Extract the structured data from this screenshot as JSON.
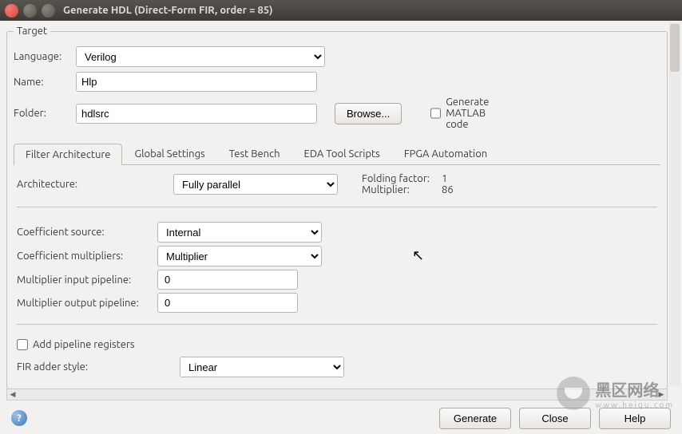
{
  "window": {
    "title": "Generate HDL (Direct-Form FIR, order = 85)"
  },
  "target": {
    "legend": "Target",
    "language_label": "Language:",
    "language_value": "Verilog",
    "name_label": "Name:",
    "name_value": "Hlp",
    "folder_label": "Folder:",
    "folder_value": "hdlsrc",
    "browse_label": "Browse...",
    "gen_matlab_label": "Generate MATLAB code"
  },
  "tabs": {
    "items": [
      {
        "label": "Filter Architecture"
      },
      {
        "label": "Global Settings"
      },
      {
        "label": "Test Bench"
      },
      {
        "label": "EDA Tool Scripts"
      },
      {
        "label": "FPGA Automation"
      }
    ]
  },
  "arch": {
    "architecture_label": "Architecture:",
    "architecture_value": "Fully parallel",
    "folding_label": "Folding factor:",
    "folding_value": "1",
    "multiplier_label": "Multiplier:",
    "multiplier_value": "86",
    "coeff_src_label": "Coefficient source:",
    "coeff_src_value": "Internal",
    "coeff_mult_label": "Coefficient multipliers:",
    "coeff_mult_value": "Multiplier",
    "mult_in_label": "Multiplier input pipeline:",
    "mult_in_value": "0",
    "mult_out_label": "Multiplier output pipeline:",
    "mult_out_value": "0",
    "add_pipe_label": "Add pipeline registers",
    "adder_style_label": "FIR adder style:",
    "adder_style_value": "Linear"
  },
  "footer": {
    "generate": "Generate",
    "close": "Close",
    "help": "Help"
  },
  "watermark": {
    "text": "黑区网络",
    "sub": "www.heiqu.com"
  }
}
